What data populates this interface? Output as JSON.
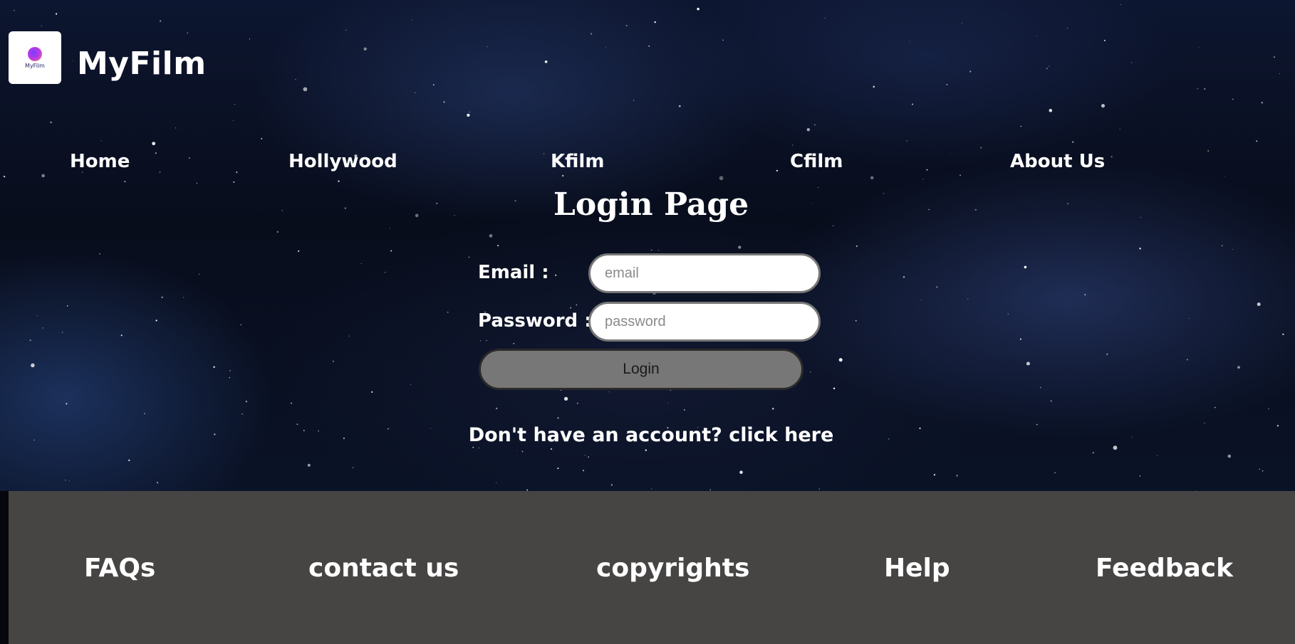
{
  "header": {
    "logo_text": "MyFilm",
    "site_title": "MyFilm"
  },
  "nav": {
    "items": [
      {
        "label": "Home"
      },
      {
        "label": "Hollywood"
      },
      {
        "label": "Kfilm"
      },
      {
        "label": "Cfilm"
      },
      {
        "label": "About Us"
      }
    ]
  },
  "login": {
    "title": "Login Page",
    "email_label": "Email  :",
    "email_placeholder": "email",
    "password_label": "Password :",
    "password_placeholder": "password",
    "button_label": "Login",
    "signup_prompt": "Don't have an account?",
    "signup_link": "click here"
  },
  "footer": {
    "links": [
      {
        "label": "FAQs"
      },
      {
        "label": "contact us"
      },
      {
        "label": "copyrights"
      },
      {
        "label": "Help"
      },
      {
        "label": "Feedback"
      }
    ]
  },
  "colors": {
    "footer_bg": "#474544",
    "button_bg": "#777777",
    "text": "#ffffff"
  }
}
